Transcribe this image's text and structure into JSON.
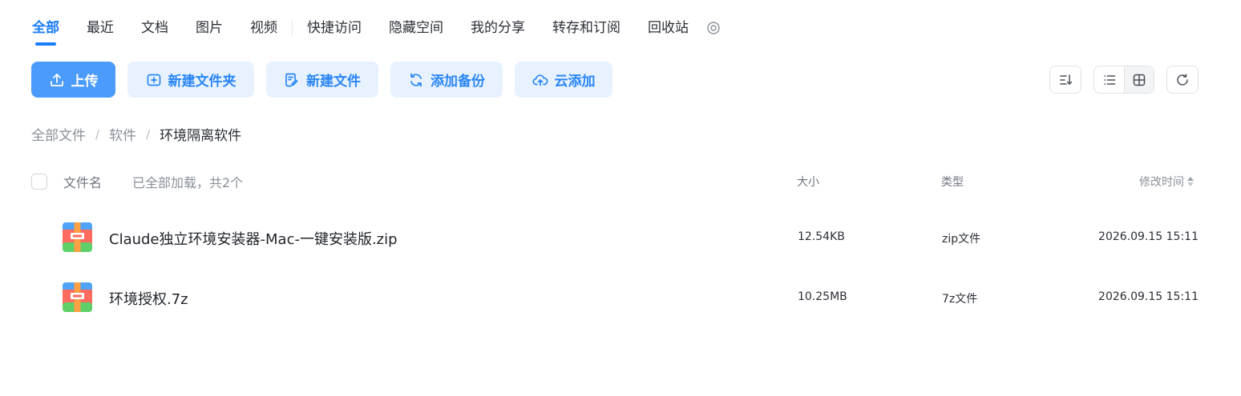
{
  "tabs": [
    {
      "label": "全部",
      "active": true
    },
    {
      "label": "最近"
    },
    {
      "label": "文档"
    },
    {
      "label": "图片"
    },
    {
      "label": "视频"
    },
    {
      "label": "快捷访问"
    },
    {
      "label": "隐藏空间"
    },
    {
      "label": "我的分享"
    },
    {
      "label": "转存和订阅"
    },
    {
      "label": "回收站"
    }
  ],
  "toolbar": {
    "upload_label": "上传",
    "new_folder_label": "新建文件夹",
    "new_file_label": "新建文件",
    "add_backup_label": "添加备份",
    "cloud_add_label": "云添加"
  },
  "breadcrumb": {
    "root": "全部文件",
    "level1": "软件",
    "current": "环境隔离软件",
    "separator": "/"
  },
  "table": {
    "col_name": "文件名",
    "load_status": "已全部加载，共2个",
    "col_size": "大小",
    "col_type": "类型",
    "col_time": "修改时间"
  },
  "files": [
    {
      "name": "Claude独立环境安装器-Mac-一键安装版.zip",
      "size": "12.54KB",
      "type": "zip文件",
      "modified": "2026.09.15 15:11",
      "icon": "archive-icon"
    },
    {
      "name": "环境授权.7z",
      "size": "10.25MB",
      "type": "7z文件",
      "modified": "2026.09.15 15:11",
      "icon": "archive-icon"
    }
  ],
  "colors": {
    "accent": "#1a7dfb",
    "primary_button": "#4a9bfb",
    "light_button": "#e8f2ff",
    "archive_top": "#4fa3f7",
    "archive_middle": "#ff6b5e",
    "archive_bottom": "#5fd068",
    "archive_strap": "#ff9f43"
  }
}
